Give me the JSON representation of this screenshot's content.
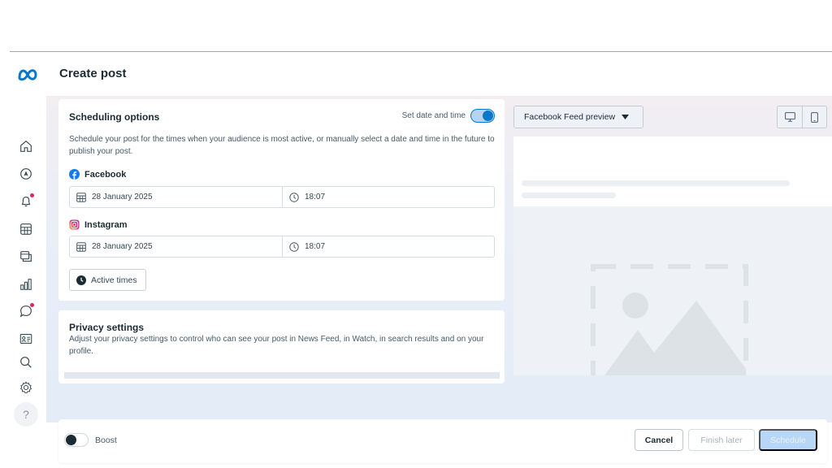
{
  "app": {
    "logo": "meta-logo",
    "title": "Create post"
  },
  "sidebar": {
    "items": [
      {
        "name": "home",
        "icon": "home-icon"
      },
      {
        "name": "navigate",
        "icon": "compass-icon"
      },
      {
        "name": "notifications",
        "icon": "bell-icon",
        "badge": true
      },
      {
        "name": "planner",
        "icon": "grid-calendar-icon"
      },
      {
        "name": "content",
        "icon": "stacked-pages-icon"
      },
      {
        "name": "insights",
        "icon": "bar-chart-icon"
      },
      {
        "name": "inbox",
        "icon": "chat-bubble-icon",
        "badge": true
      },
      {
        "name": "contacts",
        "icon": "contact-card-icon"
      },
      {
        "name": "search",
        "icon": "search-icon"
      },
      {
        "name": "settings",
        "icon": "gear-icon"
      }
    ],
    "help_label": "?"
  },
  "scheduling": {
    "title": "Scheduling options",
    "toggle_label": "Set date and time",
    "toggle_on": true,
    "description": "Schedule your post for the times when your audience is most active, or manually select a date and time in the future to publish your post.",
    "platforms": [
      {
        "name": "Facebook",
        "date": "28 January 2025",
        "time": "18:07"
      },
      {
        "name": "Instagram",
        "date": "28 January 2025",
        "time": "18:07"
      }
    ],
    "active_times_label": "Active times"
  },
  "privacy": {
    "title": "Privacy settings",
    "description": "Adjust your privacy settings to control who can see your post in News Feed, in Watch, in search results and on your profile."
  },
  "footer": {
    "boost_label": "Boost",
    "boost_on": false,
    "cancel_label": "Cancel",
    "finish_later_label": "Finish later",
    "schedule_label": "Schedule"
  },
  "preview": {
    "selector_label": "Facebook Feed preview",
    "devices": [
      "desktop-icon",
      "mobile-icon"
    ]
  },
  "colors": {
    "accent": "#0a78c8",
    "schedule_disabled": "#b8d6f5",
    "badge": "#e0245e",
    "facebook": "#1877f2"
  }
}
